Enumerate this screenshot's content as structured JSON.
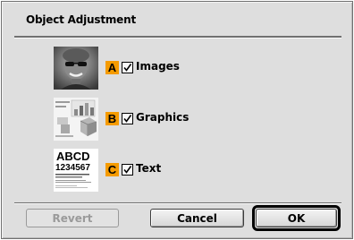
{
  "dialog": {
    "title": "Object Adjustment",
    "items": [
      {
        "badge": "A",
        "label": "Images",
        "checked": true,
        "icon": "portrait-thumbnail-icon"
      },
      {
        "badge": "B",
        "label": "Graphics",
        "checked": true,
        "icon": "graphics-thumbnail-icon"
      },
      {
        "badge": "C",
        "label": "Text",
        "checked": true,
        "icon": "text-thumbnail-icon"
      }
    ],
    "thumb_text": {
      "line1": "ABCD",
      "line2": "1234567"
    },
    "buttons": {
      "revert": "Revert",
      "cancel": "Cancel",
      "ok": "OK"
    }
  },
  "colors": {
    "badge": "#f59b00",
    "dialog_bg": "#dedede",
    "disabled_text": "#9a9a9a"
  }
}
